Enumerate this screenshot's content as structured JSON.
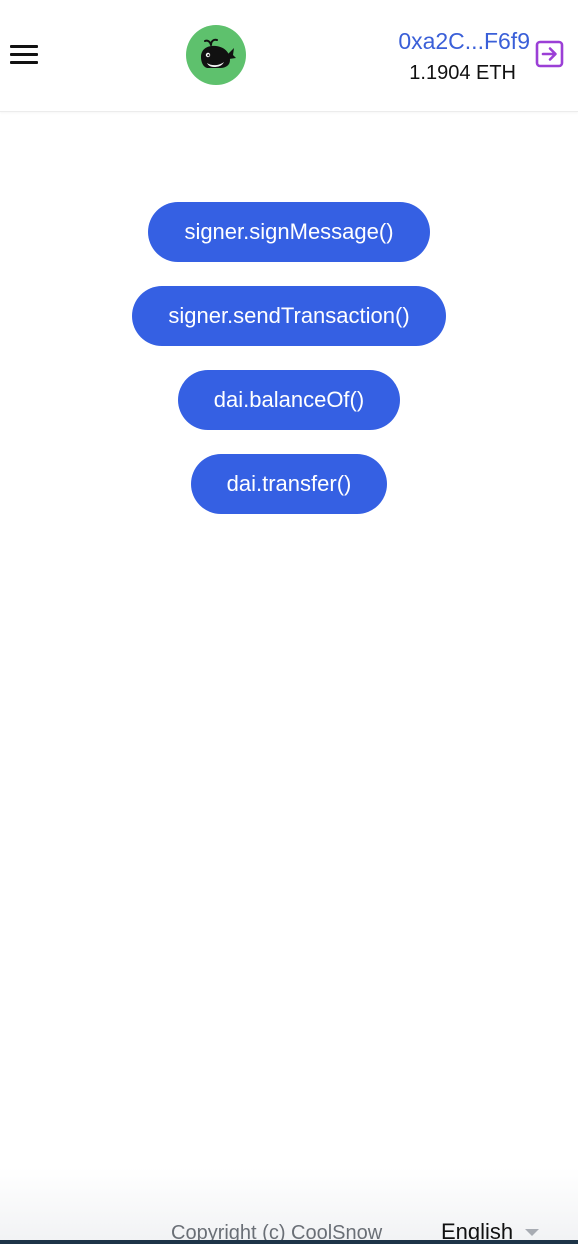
{
  "header": {
    "menu_icon": "hamburger-menu-icon",
    "logo_icon": "whale-logo-icon",
    "account": {
      "address": "0xa2C...F6f9",
      "balance": "1.1904 ETH"
    },
    "logout_icon": "logout-icon"
  },
  "actions": [
    {
      "label": "signer.signMessage()"
    },
    {
      "label": "signer.sendTransaction()"
    },
    {
      "label": "dai.balanceOf()"
    },
    {
      "label": "dai.transfer()"
    }
  ],
  "footer": {
    "copyright": "Copyright (c) CoolSnow",
    "language": "English",
    "language_caret_icon": "caret-down-icon"
  },
  "colors": {
    "primary": "#3560e3",
    "logo_bg": "#5ec16d",
    "address": "#3a5fd8",
    "logout": "#9b3fd6"
  }
}
